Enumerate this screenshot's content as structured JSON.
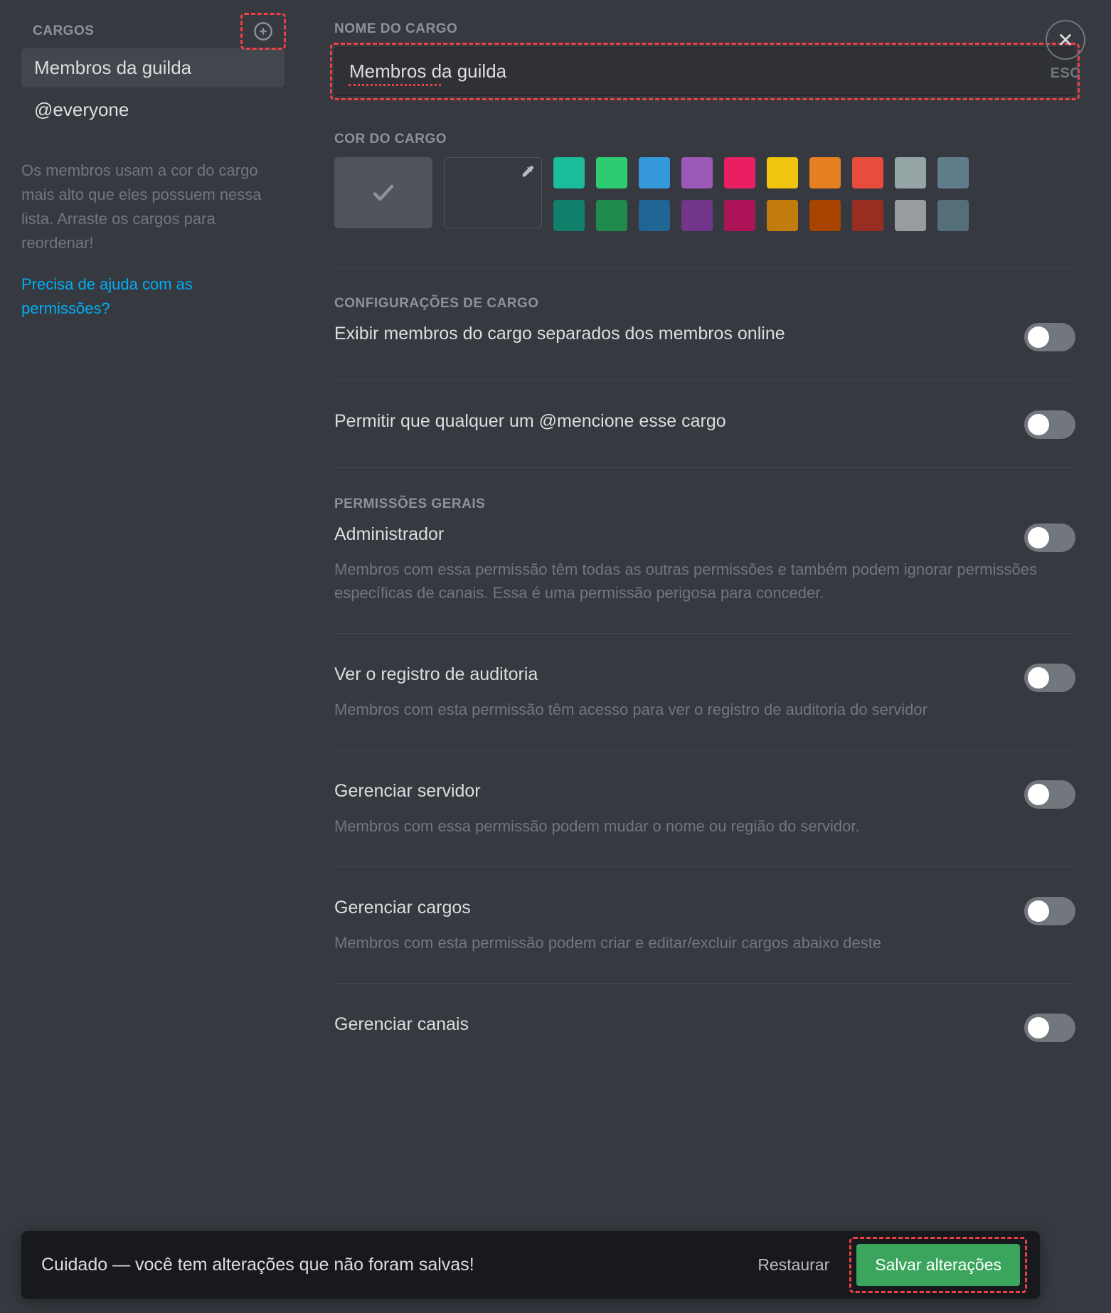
{
  "sidebar": {
    "title": "CARGOS",
    "roles": [
      {
        "label": "Membros da guilda",
        "selected": true
      },
      {
        "label": "@everyone",
        "selected": false
      }
    ],
    "help_text": "Os membros usam a cor do cargo mais alto que eles possuem nessa lista. Arraste os cargos para reordenar!",
    "help_link": "Precisa de ajuda com as permissões?"
  },
  "main": {
    "role_name_label": "NOME DO CARGO",
    "role_name_value": "Membros da guilda",
    "role_color_label": "COR DO CARGO",
    "colors_row1": [
      "#1abc9c",
      "#2ecc71",
      "#3498db",
      "#9b59b6",
      "#e91e63",
      "#f1c40f",
      "#e67e22",
      "#e74c3c",
      "#95a5a6",
      "#607d8b"
    ],
    "colors_row2": [
      "#11806a",
      "#1f8b4c",
      "#206694",
      "#71368a",
      "#ad1457",
      "#c27c0e",
      "#a84300",
      "#992d22",
      "#979c9f",
      "#546e7a"
    ],
    "role_settings_label": "CONFIGURAÇÕES DE CARGO",
    "role_settings": [
      {
        "title": "Exibir membros do cargo separados dos membros online"
      },
      {
        "title": "Permitir que qualquer um @mencione esse cargo"
      }
    ],
    "general_perms_label": "PERMISSÕES GERAIS",
    "permissions": [
      {
        "title": "Administrador",
        "desc": "Membros com essa permissão têm todas as outras permissões e também podem ignorar permissões específicas de canais. Essa é uma permissão perigosa para conceder."
      },
      {
        "title": "Ver o registro de auditoria",
        "desc": "Membros com esta permissão têm acesso para ver o registro de auditoria do servidor"
      },
      {
        "title": "Gerenciar servidor",
        "desc": "Membros com essa permissão podem mudar o nome ou região do servidor."
      },
      {
        "title": "Gerenciar cargos",
        "desc": "Membros com esta permissão podem criar e editar/excluir cargos abaixo deste"
      },
      {
        "title": "Gerenciar canais",
        "desc": ""
      }
    ]
  },
  "close": {
    "label": "ESC"
  },
  "unsaved": {
    "text": "Cuidado — você tem alterações que não foram salvas!",
    "restore": "Restaurar",
    "save": "Salvar alterações"
  }
}
